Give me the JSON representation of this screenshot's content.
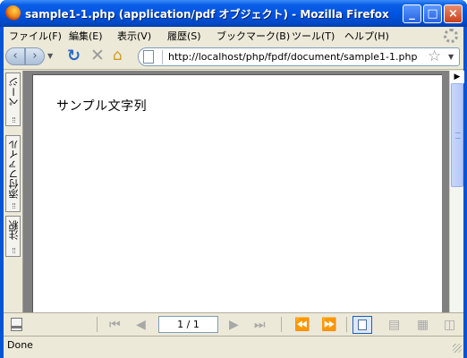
{
  "window": {
    "title": "sample1-1.php (application/pdf オブジェクト) - Mozilla Firefox",
    "minimize_label": "_",
    "maximize_label": "□",
    "close_label": "×"
  },
  "menubar": {
    "items": [
      {
        "label": "ファイル(F)"
      },
      {
        "label": "編集(E)"
      },
      {
        "label": "表示(V)"
      },
      {
        "label": "履歴(S)"
      },
      {
        "label": "ブックマーク(B)"
      },
      {
        "label": "ツール(T)"
      },
      {
        "label": "ヘルプ(H)"
      }
    ]
  },
  "navbar": {
    "back_icon": "back-arrow-icon",
    "forward_icon": "forward-arrow-icon",
    "url": "http://localhost/php/fpdf/document/sample1-1.php"
  },
  "pdf": {
    "side_tabs": [
      {
        "label": "ページ"
      },
      {
        "label": "添付ファイル"
      },
      {
        "label": "注釈"
      }
    ],
    "page_text": "サンプル文字列",
    "page_indicator": "1 / 1"
  },
  "status": {
    "text": "Done"
  },
  "colors": {
    "titlebar": "#0054e3",
    "chrome": "#ece9d8",
    "pdf_background": "#808080"
  }
}
